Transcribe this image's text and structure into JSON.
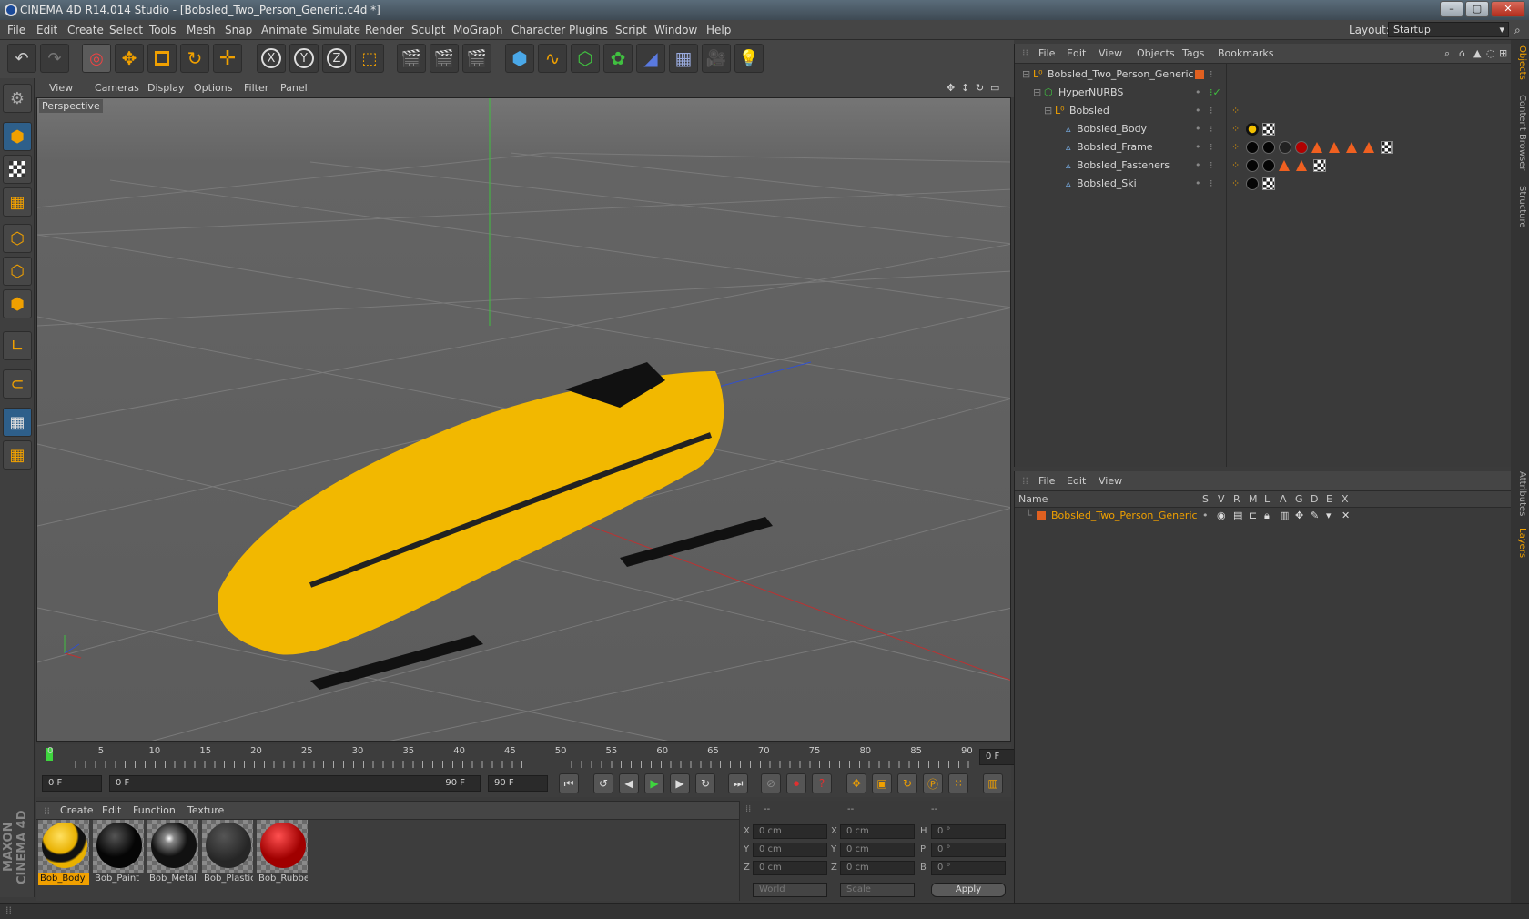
{
  "window": {
    "title": "CINEMA 4D R14.014 Studio - [Bobsled_Two_Person_Generic.c4d *]",
    "minimize": "–",
    "maximize": "▢",
    "close": "✕"
  },
  "menubar": {
    "items": [
      "File",
      "Edit",
      "Create",
      "Select",
      "Tools",
      "Mesh",
      "Snap",
      "Animate",
      "Simulate",
      "Render",
      "Sculpt",
      "MoGraph",
      "Character",
      "Plugins",
      "Script",
      "Window",
      "Help"
    ],
    "layout_label": "Layout:",
    "layout_value": "Startup"
  },
  "viewport": {
    "menu": [
      "View",
      "Cameras",
      "Display",
      "Options",
      "Filter",
      "Panel"
    ],
    "label": "Perspective"
  },
  "timeline": {
    "ticks": [
      "0",
      "5",
      "10",
      "15",
      "20",
      "25",
      "30",
      "35",
      "40",
      "45",
      "50",
      "55",
      "60",
      "65",
      "70",
      "75",
      "80",
      "85",
      "90"
    ],
    "current_frame": "0 F"
  },
  "transport": {
    "start_field": "0 F",
    "range_start": "0 F",
    "range_end": "90 F",
    "end_field": "90 F"
  },
  "materials": {
    "menu": [
      "Create",
      "Edit",
      "Function",
      "Texture"
    ],
    "items": [
      {
        "name": "Bob_Body",
        "selected": true
      },
      {
        "name": "Bob_Paint",
        "selected": false
      },
      {
        "name": "Bob_Metal",
        "selected": false
      },
      {
        "name": "Bob_Plastic",
        "selected": false
      },
      {
        "name": "Bob_Rubber",
        "selected": false
      }
    ]
  },
  "coordinates": {
    "header": [
      "--",
      "--",
      "--"
    ],
    "rows": [
      {
        "l1": "X",
        "v1": "0 cm",
        "l2": "X",
        "v2": "0 cm",
        "l3": "H",
        "v3": "0 °"
      },
      {
        "l1": "Y",
        "v1": "0 cm",
        "l2": "Y",
        "v2": "0 cm",
        "l3": "P",
        "v3": "0 °"
      },
      {
        "l1": "Z",
        "v1": "0 cm",
        "l2": "Z",
        "v2": "0 cm",
        "l3": "B",
        "v3": "0 °"
      }
    ],
    "mode1": "World",
    "mode2": "Scale",
    "apply": "Apply"
  },
  "objects": {
    "menu": [
      "File",
      "Edit",
      "View",
      "Objects",
      "Tags",
      "Bookmarks"
    ],
    "tree": [
      {
        "name": "Bobsled_Two_Person_Generic",
        "indent": 0
      },
      {
        "name": "HyperNURBS",
        "indent": 1
      },
      {
        "name": "Bobsled",
        "indent": 2
      },
      {
        "name": "Bobsled_Body",
        "indent": 3
      },
      {
        "name": "Bobsled_Frame",
        "indent": 3
      },
      {
        "name": "Bobsled_Fasteners",
        "indent": 3
      },
      {
        "name": "Bobsled_Ski",
        "indent": 3
      }
    ]
  },
  "layers": {
    "menu": [
      "File",
      "Edit",
      "View"
    ],
    "name_header": "Name",
    "columns": [
      "S",
      "V",
      "R",
      "M",
      "L",
      "A",
      "G",
      "D",
      "E",
      "X"
    ],
    "rows": [
      {
        "name": "Bobsled_Two_Person_Generic"
      }
    ]
  },
  "sidetabs": [
    "Objects",
    "Content Browser",
    "Structure",
    "Attributes",
    "Layers"
  ],
  "brand": "MAXON CINEMA 4D",
  "colors": {
    "accent": "#f0a000",
    "selected_row": "#f0a000",
    "x_axis": "#c03030",
    "y_axis": "#30c030",
    "z_axis": "#3050d0",
    "bobsled": "#f2b800"
  }
}
